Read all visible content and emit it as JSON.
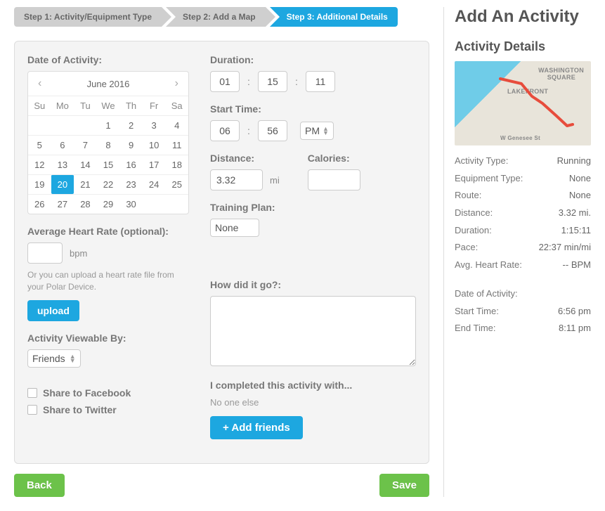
{
  "wizard": {
    "step1": "Step 1: Activity/Equipment Type",
    "step2": "Step 2: Add a Map",
    "step3": "Step 3: Additional Details"
  },
  "form": {
    "date_label": "Date of Activity:",
    "calendar": {
      "month_title": "June 2016",
      "dow": [
        "Su",
        "Mo",
        "Tu",
        "We",
        "Th",
        "Fr",
        "Sa"
      ],
      "weeks": [
        [
          "",
          "",
          "",
          "1",
          "2",
          "3",
          "4"
        ],
        [
          "5",
          "6",
          "7",
          "8",
          "9",
          "10",
          "11"
        ],
        [
          "12",
          "13",
          "14",
          "15",
          "16",
          "17",
          "18"
        ],
        [
          "19",
          "20",
          "21",
          "22",
          "23",
          "24",
          "25"
        ],
        [
          "26",
          "27",
          "28",
          "29",
          "30",
          "",
          ""
        ]
      ],
      "selected_day": "20"
    },
    "hr_label": "Average Heart Rate (optional):",
    "hr_unit": "bpm",
    "hr_upload_note": "Or you can upload a heart rate file from your Polar Device.",
    "upload_btn": "upload",
    "visibility_label": "Activity Viewable By:",
    "visibility_value": "Friends",
    "share_fb": "Share to Facebook",
    "share_tw": "Share to Twitter",
    "duration_label": "Duration:",
    "duration_h": "01",
    "duration_m": "15",
    "duration_s": "11",
    "start_label": "Start Time:",
    "start_h": "06",
    "start_m": "56",
    "start_ampm": "PM",
    "distance_label": "Distance:",
    "distance_value": "3.32",
    "distance_unit": "mi",
    "calories_label": "Calories:",
    "plan_label": "Training Plan:",
    "plan_value": "None",
    "notes_label": "How did it go?:",
    "with_label": "I completed this activity with...",
    "with_value": "No one else",
    "add_friends": "+ Add friends"
  },
  "footer": {
    "back": "Back",
    "save": "Save"
  },
  "sidebar": {
    "title": "Add An Activity",
    "details_title": "Activity Details",
    "map_labels": {
      "l1": "LAKEFRONT",
      "l2": "WASHINGTON",
      "l3": "SQUARE",
      "l4": "W Genesee St"
    },
    "rows1": [
      {
        "k": "Activity Type:",
        "v": "Running"
      },
      {
        "k": "Equipment Type:",
        "v": "None"
      },
      {
        "k": "Route:",
        "v": "None"
      },
      {
        "k": "Distance:",
        "v": "3.32 mi."
      },
      {
        "k": "Duration:",
        "v": "1:15:11"
      },
      {
        "k": "Pace:",
        "v": "22:37 min/mi"
      },
      {
        "k": "Avg. Heart Rate:",
        "v": "-- BPM"
      }
    ],
    "rows2": [
      {
        "k": "Date of Activity:",
        "v": ""
      },
      {
        "k": "Start Time:",
        "v": "6:56 pm"
      },
      {
        "k": "End Time:",
        "v": "8:11 pm"
      }
    ]
  }
}
